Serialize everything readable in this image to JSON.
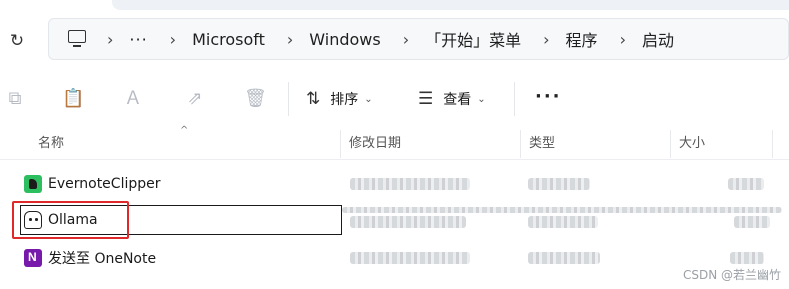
{
  "address_bar": {
    "overflow": "···",
    "crumbs": [
      "Microsoft",
      "Windows",
      "「开始」菜单",
      "程序",
      "启动"
    ]
  },
  "toolbar": {
    "sort_label": "排序",
    "view_label": "查看",
    "more_label": "···"
  },
  "columns": [
    "名称",
    "修改日期",
    "类型",
    "大小"
  ],
  "files": [
    {
      "name": "EvernoteClipper",
      "icon": "evernote-icon"
    },
    {
      "name": "Ollama",
      "icon": "ollama-icon",
      "selected": true,
      "highlighted": true
    },
    {
      "name": "发送至 OneNote",
      "icon": "onenote-icon"
    }
  ],
  "watermark": "CSDN @若兰幽竹",
  "colors": {
    "highlight": "#e02828",
    "accent": "#2dbe60"
  }
}
